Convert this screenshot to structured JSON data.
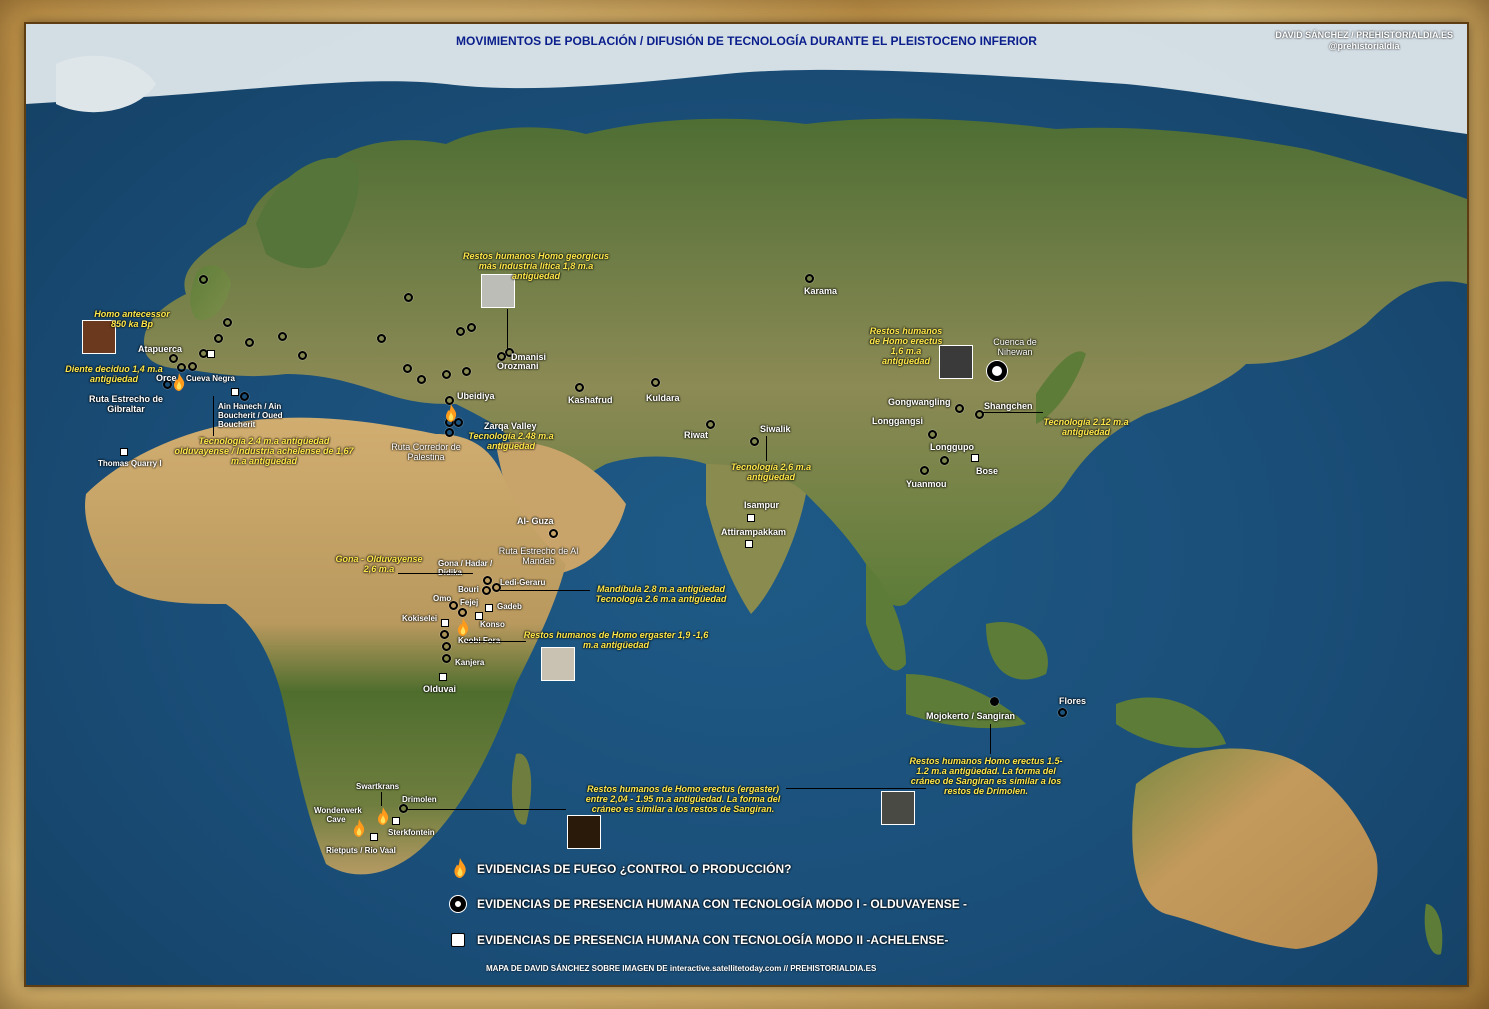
{
  "title": "MOVIMIENTOS DE POBLACIÓN / DIFUSIÓN DE TECNOLOGÍA DURANTE EL PLEISTOCENO INFERIOR",
  "credit": {
    "line1": "DAVID SÁNCHEZ / PREHISTORIALDIA.ES",
    "line2": "@prehistorialdia"
  },
  "footer": "MAPA DE DAVID SÁNCHEZ SOBRE IMAGEN DE interactive.satellitetoday.com // PREHISTORIALDIA.ES",
  "colors": {
    "ocean": "#1a4e78",
    "land": "#6a8a3c",
    "desert": "#c9a46a",
    "ice": "#e8eef2",
    "note": "#ffe84a",
    "title": "#0a1e8c",
    "frame": "#c89a4e"
  },
  "legend": {
    "fire": "EVIDENCIAS DE FUEGO ¿CONTROL O PRODUCCIÓN?",
    "mode1": "EVIDENCIAS DE PRESENCIA HUMANA CON TECNOLOGÍA MODO  I - OLDUVAYENSE -",
    "mode2": "EVIDENCIAS DE PRESENCIA HUMANA CON TECNOLOGÍA MODO II -ACHELENSE-"
  },
  "sites": {
    "karama": "Karama",
    "nihewan": "Cuenca de Nihewan",
    "atapuerca": "Atapuerca",
    "orce": "Orce",
    "cueva_negra": "Cueva Negra",
    "ain_hanech": "Ain Hanech / Ain Boucherit / Oued Boucherit",
    "gibraltar": "Ruta Estrecho de Gibraltar",
    "thomas": "Thomas Quarry I",
    "dmanisi": "Dmanisi",
    "orozmani": "Orozmani",
    "ubeidiya": "Ubeidiya",
    "zarqa": "Zarqa Valley",
    "palestina": "Ruta Corredor de Palestina",
    "kashafrud": "Kashafrud",
    "kuldara": "Kuldara",
    "riwat": "Riwat",
    "siwalik": "Siwalik",
    "gongwangling": "Gongwangling",
    "shangchen": "Shangchen",
    "longgangsi": "Longgangsi",
    "longgupo": "Longgupo",
    "bose": "Bose",
    "yuanmou": "Yuanmou",
    "isampur": "Isampur",
    "attirampakkam": "Attirampakkam",
    "alguza": "Al- Guza",
    "mandeb": "Ruta Estrecho de Al Mandeb",
    "gona": "Gona / Hadar / Didika",
    "ledi": "Ledi-Geraru",
    "bouri": "Bouri",
    "omo": "Omo",
    "fejej": "Fejej",
    "gadeb": "Gadeb",
    "konso": "Konso",
    "kokiselei": "Kokiselei",
    "koobi": "Koobi Fora",
    "kanjera": "Kanjera",
    "olduvai": "Olduvai",
    "mojokerto": "Mojokerto / Sangiran",
    "flores": "Flores",
    "swartkrans": "Swartkrans",
    "drimolen": "Drimolen",
    "wonderwerk": "Wonderwerk Cave",
    "sterkfontein": "Sterkfontein",
    "rietputs": "Rietputs / Rio Vaal"
  },
  "notes": {
    "antecessor": "Homo antecessor 850 ka Bp",
    "diente": "Diente deciduo 1,4 m.a antigüedad",
    "georgicus": "Restos humanos Homo georgicus más industria lítica 1,8 m.a antigüedad",
    "erectus_china": "Restos humanos de Homo erectus 1,6 m.a antigüedad",
    "tec_212": "Tecnología 2.12 m.a antigüedad",
    "tec_24": "Tecnología 2.4 m.a antigüedad olduvayense / Industria achelense de 1,67 m.a antigüedad",
    "tec_248": "Tecnología 2.48 m.a antigüedad",
    "tec_26_siwalik": "Tecnología 2,6 m.a antigüedad",
    "gona": "Gona - Olduvayense 2,6 m.a",
    "mandibula": "Mandíbula 2.8 m.a antigüedad Tecnología 2.6 m.a antigüedad",
    "ergaster": "Restos humanos de Homo ergaster 1,9 -1,6 m.a antigüedad",
    "erectus_java": "Restos humanos Homo erectus 1.5-1.2 m.a antigüedad. La forma del cráneo de Sangiran es similar a los restos de Drimolen.",
    "erectus_ergaster": "Restos humanos de Homo erectus (ergaster) entre 2,04 - 1.95 m.a antigüedad. La forma del cráneo es similar a los restos de Sangiran."
  }
}
